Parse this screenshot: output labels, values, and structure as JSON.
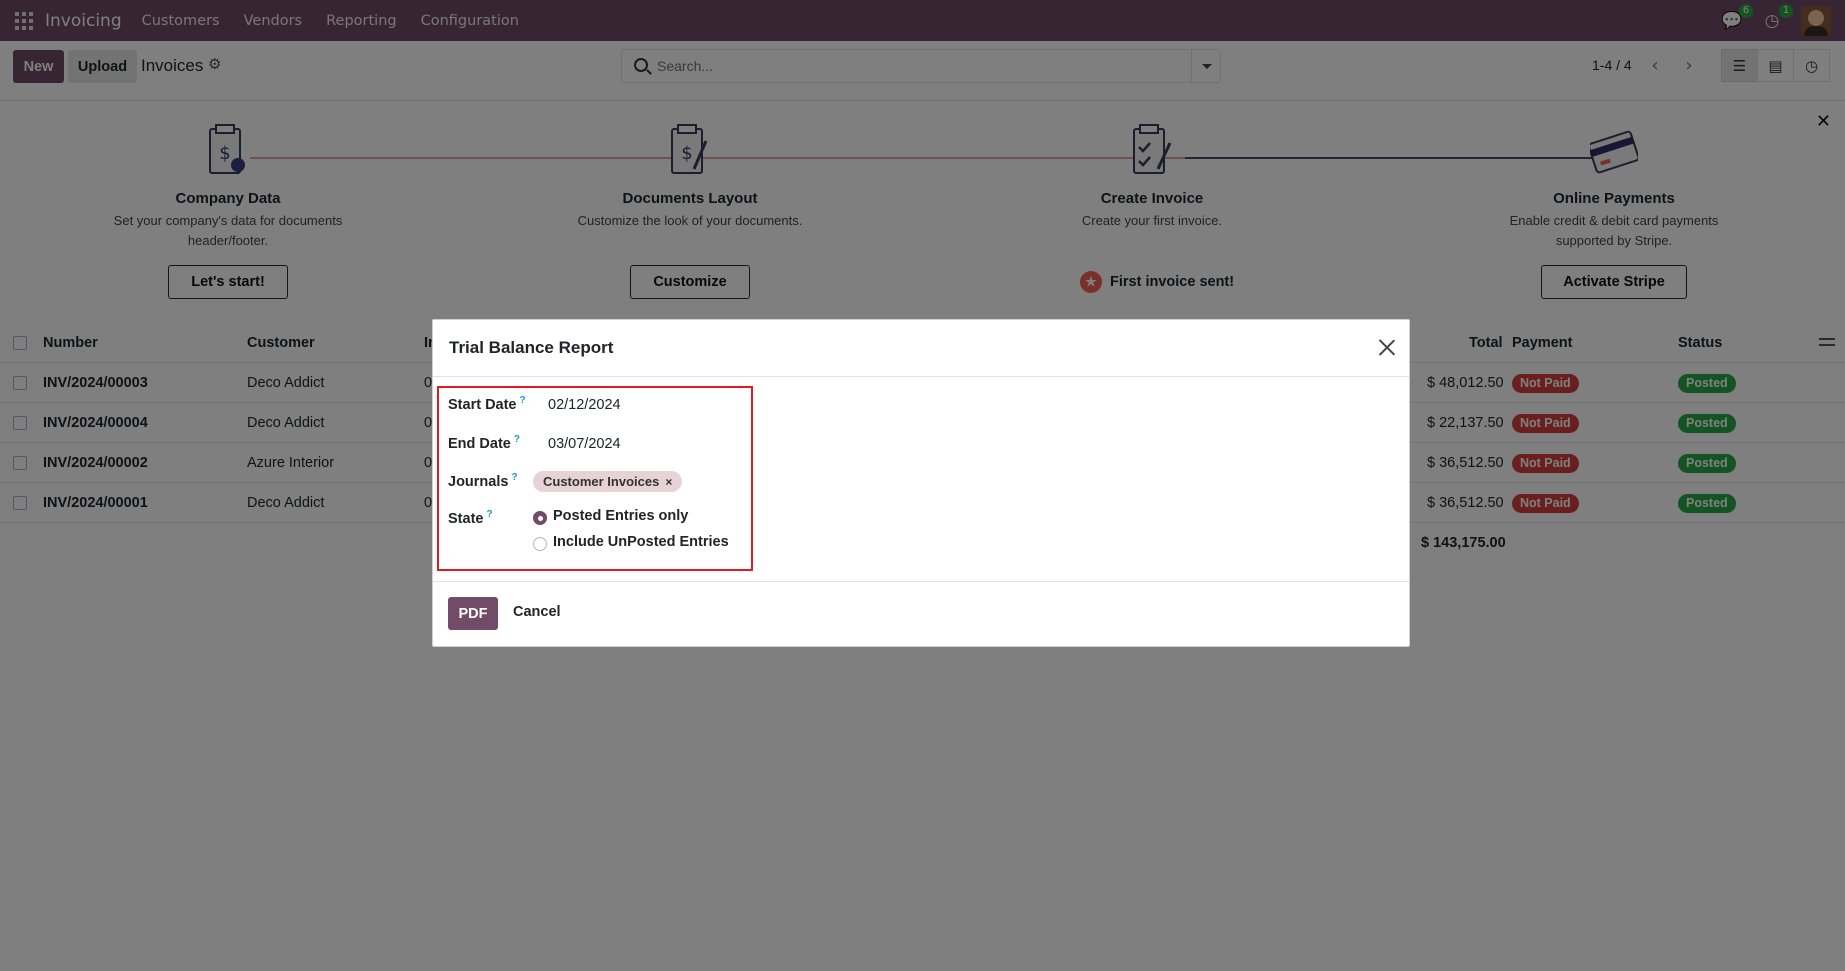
{
  "navbar": {
    "brand": "Invoicing",
    "menu": [
      "Customers",
      "Vendors",
      "Reporting",
      "Configuration"
    ],
    "messages_badge": "6",
    "activities_badge": "1",
    "accent": "#714b67"
  },
  "control_panel": {
    "new_label": "New",
    "upload_label": "Upload",
    "title": "Invoices",
    "search_placeholder": "Search...",
    "pager": "1-4 / 4"
  },
  "onboarding": {
    "steps": [
      {
        "title": "Company Data",
        "desc_line1": "Set your company's data for documents",
        "desc_line2": "header/footer.",
        "button": "Let's start!"
      },
      {
        "title": "Documents Layout",
        "desc_line1": "Customize the look of your documents.",
        "desc_line2": "",
        "button": "Customize"
      },
      {
        "title": "Create Invoice",
        "desc_line1": "Create your first invoice.",
        "desc_line2": "",
        "done": "First invoice sent!"
      },
      {
        "title": "Online Payments",
        "desc_line1": "Enable credit & debit card payments",
        "desc_line2": "supported by Stripe.",
        "button": "Activate Stripe"
      }
    ]
  },
  "list": {
    "headers": {
      "number": "Number",
      "customer": "Customer",
      "invoice_date_partial": "In",
      "total": "Total",
      "payment": "Payment",
      "status": "Status"
    },
    "rows": [
      {
        "number": "INV/2024/00003",
        "customer": "Deco Addict",
        "partial": "0",
        "total": "$ 48,012.50",
        "payment": "Not Paid",
        "status": "Posted"
      },
      {
        "number": "INV/2024/00004",
        "customer": "Deco Addict",
        "partial": "0",
        "total": "$ 22,137.50",
        "payment": "Not Paid",
        "status": "Posted"
      },
      {
        "number": "INV/2024/00002",
        "customer": "Azure Interior",
        "partial": "0",
        "total": "$ 36,512.50",
        "payment": "Not Paid",
        "status": "Posted"
      },
      {
        "number": "INV/2024/00001",
        "customer": "Deco Addict",
        "partial": "0",
        "total": "$ 36,512.50",
        "payment": "Not Paid",
        "status": "Posted"
      }
    ],
    "grand_total": "$ 143,175.00"
  },
  "modal": {
    "title": "Trial Balance Report",
    "start_date_label": "Start Date",
    "start_date": "02/12/2024",
    "end_date_label": "End Date",
    "end_date": "03/07/2024",
    "journals_label": "Journals",
    "journal_tag": "Customer Invoices",
    "state_label": "State",
    "state_options": [
      "Posted Entries only",
      "Include UnPosted Entries"
    ],
    "state_selected": "Posted Entries only",
    "help_marker": "?",
    "pdf_label": "PDF",
    "cancel_label": "Cancel"
  }
}
